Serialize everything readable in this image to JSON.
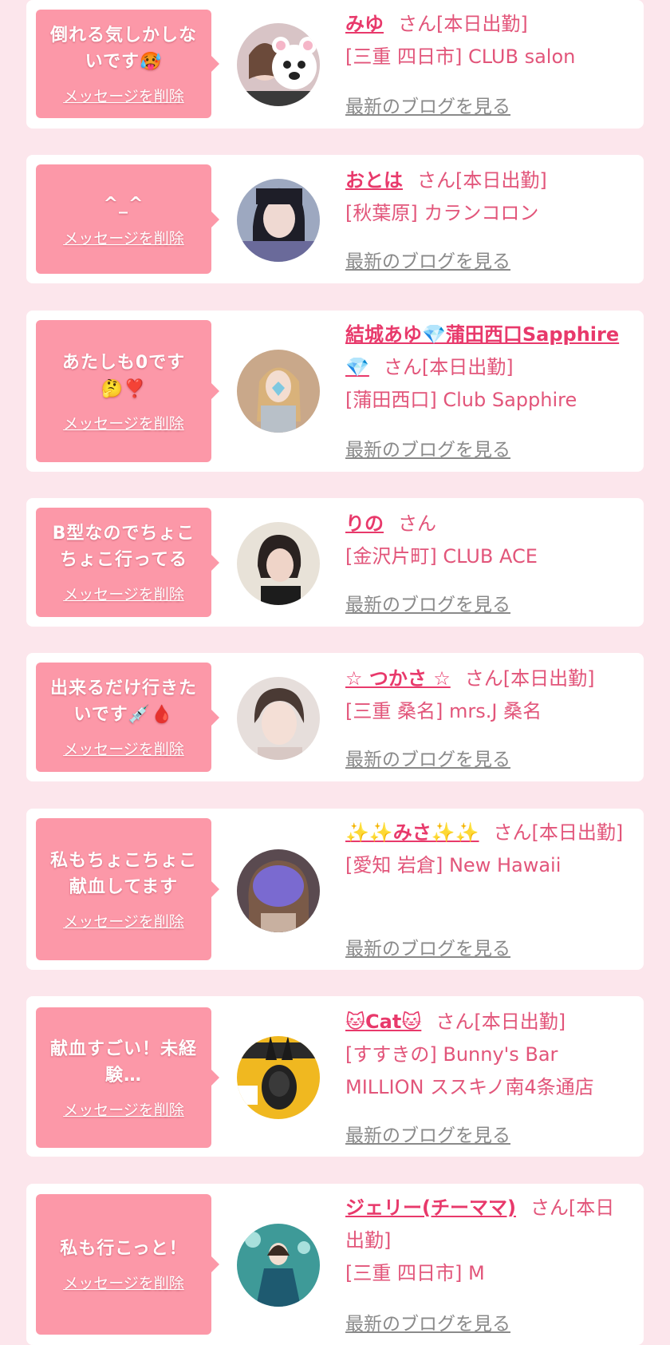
{
  "delete_label": "メッセージを削除",
  "blog_label": "最新のブログを見る",
  "entries": [
    {
      "message": "倒れる気しかしないです🥵",
      "name": "みゆ",
      "suffix": "さん[本日出勤]",
      "shop": "[三重 四日市] CLUB salon",
      "avatar": "polar-bear-filter-photo"
    },
    {
      "message": "^_^",
      "name": "おとは",
      "suffix": "さん[本日出勤]",
      "shop": "[秋葉原] カランコロン",
      "avatar": "dark-hair-photo"
    },
    {
      "message": "あたしも0です🤔❣️",
      "name": "結城あゆ💎蒲田西口Sapphire💎",
      "suffix": "さん[本日出勤]",
      "shop": "[蒲田西口] Club Sapphire",
      "avatar": "heart-covered-photo"
    },
    {
      "message": "B型なのでちょこちょこ行ってる",
      "name": "りの",
      "suffix": "さん",
      "shop": "[金沢片町] CLUB ACE",
      "avatar": "short-hair-photo"
    },
    {
      "message": "出来るだけ行きたいです💉🩸",
      "name": "☆ つかさ ☆",
      "suffix": "さん[本日出勤]",
      "shop": "[三重 桑名] mrs.J 桑名",
      "avatar": "portrait-photo"
    },
    {
      "message": "私もちょこちょこ献血してます",
      "name": "✨✨みさ✨✨",
      "suffix": "さん[本日出勤]",
      "shop": "[愛知 岩倉] New Hawaii",
      "avatar": "purple-blurred-photo"
    },
    {
      "message": "献血すごい！未経験…",
      "name": "🐱Cat🐱",
      "suffix": "さん[本日出勤]",
      "shop": "[すすきの] Bunny's Bar MILLION ススキノ南4条通店",
      "avatar": "million-magazine-photo"
    },
    {
      "message": "私も行こっと！",
      "name": "ジェリー(チーママ)",
      "suffix": "さん[本日出勤]",
      "shop": "[三重 四日市] M",
      "avatar": "teal-dress-photo"
    }
  ]
}
